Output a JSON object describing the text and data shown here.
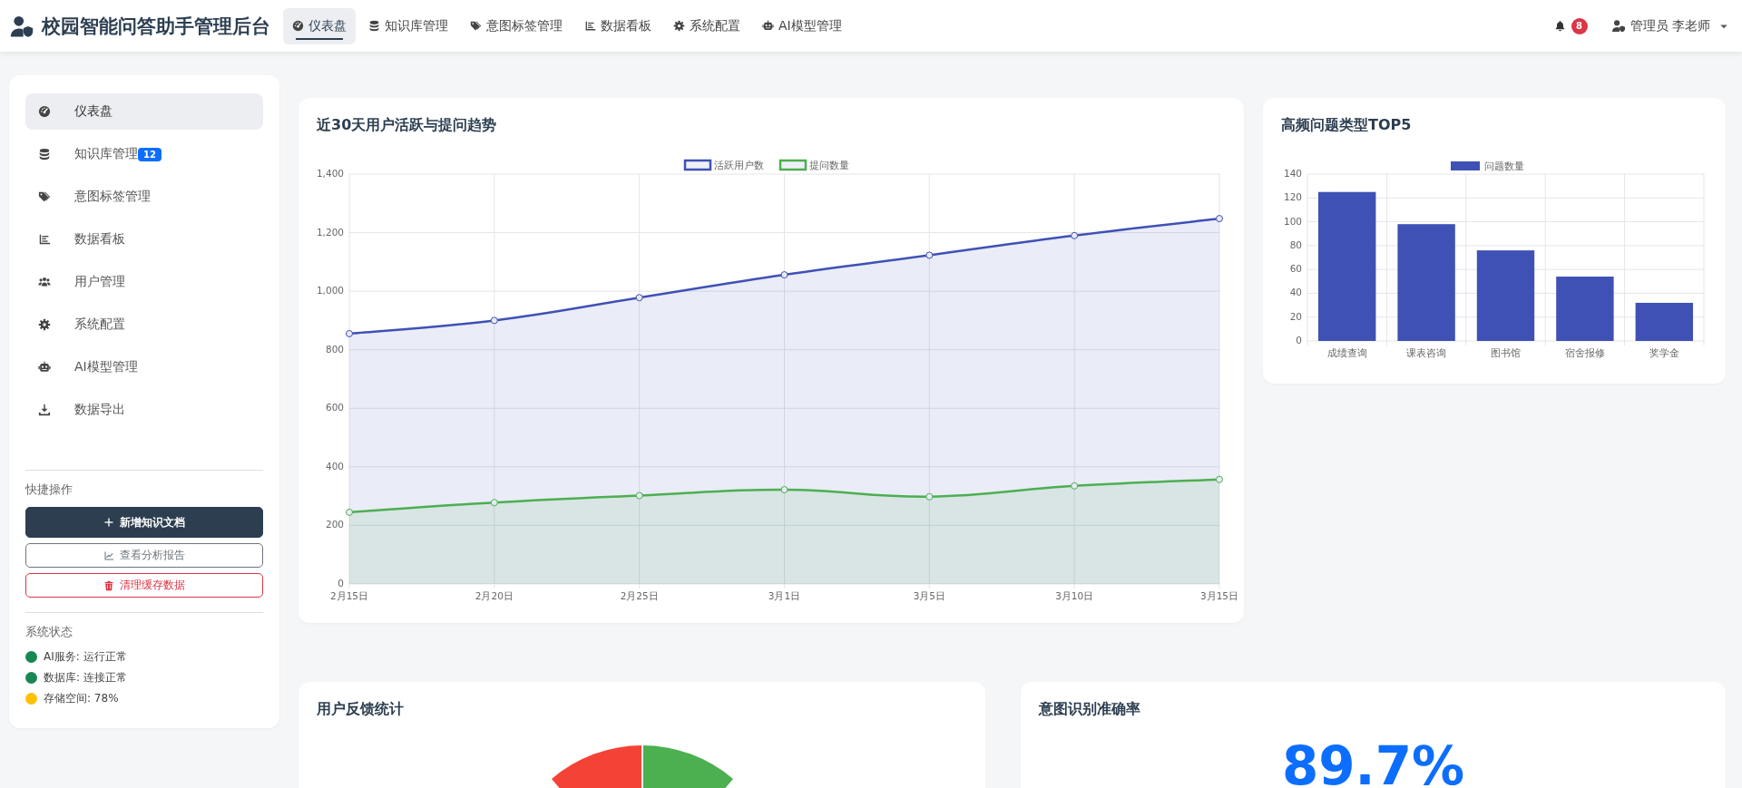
{
  "header": {
    "title": "校园智能问答助手管理后台",
    "nav": [
      {
        "label": "仪表盘",
        "selected": true
      },
      {
        "label": "知识库管理",
        "selected": false
      },
      {
        "label": "意图标签管理",
        "selected": false
      },
      {
        "label": "数据看板",
        "selected": false
      },
      {
        "label": "系统配置",
        "selected": false
      },
      {
        "label": "AI模型管理",
        "selected": false
      }
    ],
    "notifications": "8",
    "user": "管理员 李老师"
  },
  "sidebar": {
    "items": [
      {
        "label": "仪表盘",
        "selected": true
      },
      {
        "label": "知识库管理",
        "selected": false,
        "badge": "12"
      },
      {
        "label": "意图标签管理",
        "selected": false
      },
      {
        "label": "数据看板",
        "selected": false
      },
      {
        "label": "用户管理",
        "selected": false
      },
      {
        "label": "系统配置",
        "selected": false
      },
      {
        "label": "AI模型管理",
        "selected": false
      },
      {
        "label": "数据导出",
        "selected": false
      }
    ],
    "quick_title": "快捷操作",
    "actions": [
      {
        "label": "新增知识文档",
        "kind": "primary"
      },
      {
        "label": "查看分析报告",
        "kind": "outline"
      },
      {
        "label": "清理缓存数据",
        "kind": "danger"
      }
    ],
    "status_title": "系统状态",
    "status": [
      {
        "label": "AI服务: 运行正常",
        "color": "#198754"
      },
      {
        "label": "数据库: 连接正常",
        "color": "#198754"
      },
      {
        "label": "存储空间: 78%",
        "color": "#ffc107"
      }
    ]
  },
  "trend": {
    "title": "近30天用户活跃与提问趋势",
    "chart_data": {
      "type": "area",
      "categories": [
        "2月15日",
        "2月20日",
        "2月25日",
        "3月1日",
        "3月5日",
        "3月10日",
        "3月15日"
      ],
      "series": [
        {
          "name": "活跃用户数",
          "color": "#3f51b5",
          "values": [
            855,
            900,
            978,
            1056,
            1123,
            1190,
            1248
          ]
        },
        {
          "name": "提问数量",
          "color": "#4caf50",
          "values": [
            245,
            278,
            302,
            322,
            298,
            335,
            357
          ]
        }
      ],
      "grid": true,
      "legend": "top",
      "ylim": [
        0,
        1400
      ],
      "yticks": [
        0,
        200,
        400,
        600,
        800,
        {
          "value": 1000,
          "label": "1,000"
        },
        {
          "value": 1200,
          "label": "1,200"
        },
        {
          "value": 1400,
          "label": "1,400"
        }
      ]
    }
  },
  "top5": {
    "title": "高频问题类型TOP5",
    "chart_data": {
      "type": "bar",
      "categories": [
        "成绩查询",
        "课表咨询",
        "图书馆",
        "宿舍报修",
        "奖学金"
      ],
      "series": [
        {
          "name": "问题数量",
          "color": "#3f51b5",
          "values": [
            125,
            98,
            76,
            54,
            32
          ]
        }
      ],
      "grid": true,
      "legend": "top",
      "ylim": [
        0,
        140
      ],
      "yticks": [
        0,
        20,
        40,
        60,
        80,
        100,
        120,
        140
      ]
    }
  },
  "feedback": {
    "title": "用户反馈统计"
  },
  "accuracy": {
    "title": "意图识别准确率",
    "value": "89.7%"
  }
}
